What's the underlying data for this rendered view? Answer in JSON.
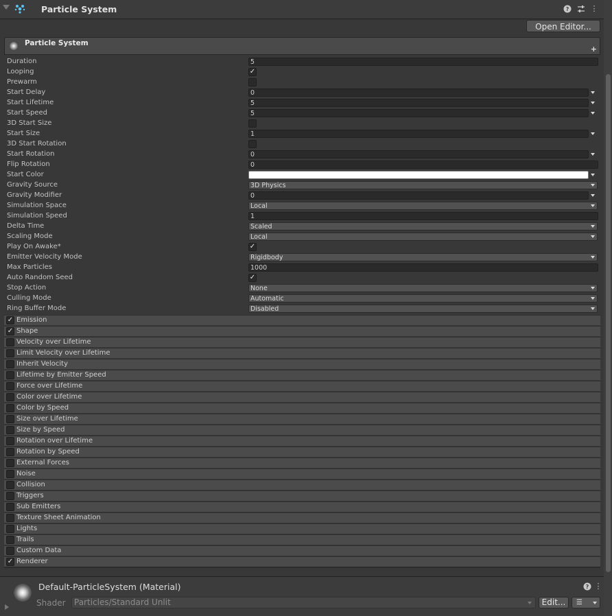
{
  "component": {
    "title": "Particle System",
    "help_icon": "?",
    "preset_icon": "⇄",
    "menu_icon": "⋮"
  },
  "open_editor_label": "Open Editor...",
  "main_module": {
    "title": "Particle System",
    "add_icon": "+"
  },
  "properties": [
    {
      "label": "Duration",
      "kind": "number",
      "value": "5"
    },
    {
      "label": "Looping",
      "kind": "check",
      "checked": true
    },
    {
      "label": "Prewarm",
      "kind": "check",
      "checked": false
    },
    {
      "label": "Start Delay",
      "kind": "curve",
      "value": "0"
    },
    {
      "label": "Start Lifetime",
      "kind": "curve",
      "value": "5"
    },
    {
      "label": "Start Speed",
      "kind": "curve",
      "value": "5"
    },
    {
      "label": "3D Start Size",
      "kind": "check",
      "checked": false
    },
    {
      "label": "Start Size",
      "kind": "curve",
      "value": "1"
    },
    {
      "label": "3D Start Rotation",
      "kind": "check",
      "checked": false
    },
    {
      "label": "Start Rotation",
      "kind": "curve",
      "value": "0"
    },
    {
      "label": "Flip Rotation",
      "kind": "number",
      "value": "0"
    },
    {
      "label": "Start Color",
      "kind": "color",
      "value": "#ffffff"
    },
    {
      "label": "Gravity Source",
      "kind": "dropdown",
      "value": "3D Physics"
    },
    {
      "label": "Gravity Modifier",
      "kind": "curve",
      "value": "0"
    },
    {
      "label": "Simulation Space",
      "kind": "dropdown",
      "value": "Local"
    },
    {
      "label": "Simulation Speed",
      "kind": "number",
      "value": "1"
    },
    {
      "label": "Delta Time",
      "kind": "dropdown",
      "value": "Scaled"
    },
    {
      "label": "Scaling Mode",
      "kind": "dropdown",
      "value": "Local"
    },
    {
      "label": "Play On Awake*",
      "kind": "check",
      "checked": true
    },
    {
      "label": "Emitter Velocity Mode",
      "kind": "dropdown",
      "value": "Rigidbody"
    },
    {
      "label": "Max Particles",
      "kind": "number",
      "value": "1000"
    },
    {
      "label": "Auto Random Seed",
      "kind": "check",
      "checked": true
    },
    {
      "label": "Stop Action",
      "kind": "dropdown",
      "value": "None"
    },
    {
      "label": "Culling Mode",
      "kind": "dropdown",
      "value": "Automatic"
    },
    {
      "label": "Ring Buffer Mode",
      "kind": "dropdown",
      "value": "Disabled"
    }
  ],
  "modules": [
    {
      "label": "Emission",
      "enabled": true
    },
    {
      "label": "Shape",
      "enabled": true
    },
    {
      "label": "Velocity over Lifetime",
      "enabled": false
    },
    {
      "label": "Limit Velocity over Lifetime",
      "enabled": false
    },
    {
      "label": "Inherit Velocity",
      "enabled": false
    },
    {
      "label": "Lifetime by Emitter Speed",
      "enabled": false
    },
    {
      "label": "Force over Lifetime",
      "enabled": false
    },
    {
      "label": "Color over Lifetime",
      "enabled": false
    },
    {
      "label": "Color by Speed",
      "enabled": false
    },
    {
      "label": "Size over Lifetime",
      "enabled": false
    },
    {
      "label": "Size by Speed",
      "enabled": false
    },
    {
      "label": "Rotation over Lifetime",
      "enabled": false
    },
    {
      "label": "Rotation by Speed",
      "enabled": false
    },
    {
      "label": "External Forces",
      "enabled": false
    },
    {
      "label": "Noise",
      "enabled": false
    },
    {
      "label": "Collision",
      "enabled": false
    },
    {
      "label": "Triggers",
      "enabled": false
    },
    {
      "label": "Sub Emitters",
      "enabled": false
    },
    {
      "label": "Texture Sheet Animation",
      "enabled": false
    },
    {
      "label": "Lights",
      "enabled": false
    },
    {
      "label": "Trails",
      "enabled": false
    },
    {
      "label": "Custom Data",
      "enabled": false
    },
    {
      "label": "Renderer",
      "enabled": true
    }
  ],
  "material": {
    "name": "Default-ParticleSystem (Material)",
    "shader_label": "Shader",
    "shader_value": "Particles/Standard Unlit",
    "edit_label": "Edit...",
    "list_icon": "☰",
    "help_icon": "?",
    "menu_icon": "⋮"
  },
  "check_glyph": "✓"
}
